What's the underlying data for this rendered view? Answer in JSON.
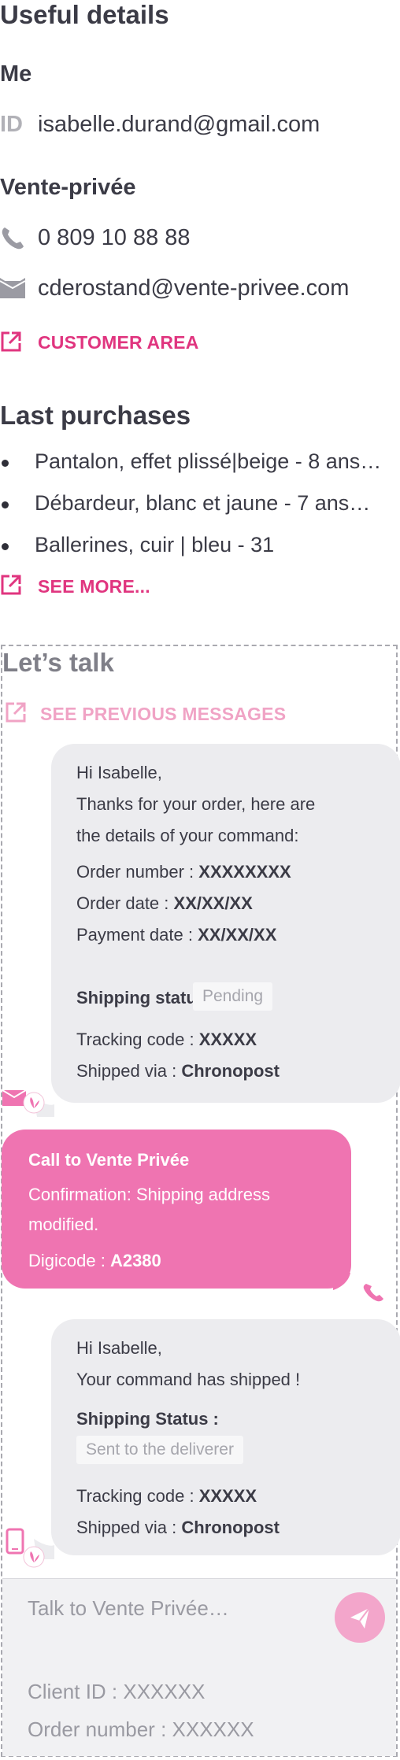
{
  "useful_details": {
    "title": "Useful details",
    "me": {
      "heading": "Me",
      "id_label": "ID",
      "email": "isabelle.durand@gmail.com"
    },
    "vente_privee": {
      "heading": "Vente-privée",
      "phone": "0 809 10 88 88",
      "email": "cderostand@vente-privee.com",
      "customer_area_link": "CUSTOMER AREA"
    }
  },
  "last_purchases": {
    "title": "Last purchases",
    "items": [
      "Pantalon, effet plissé|beige - 8 ans…",
      "Débardeur, blanc et jaune - 7 ans…",
      "Ballerines, cuir | bleu - 31"
    ],
    "see_more_link": "SEE MORE..."
  },
  "talk": {
    "title": "Let’s talk",
    "previous_link": "SEE PREVIOUS MESSAGES",
    "message1": {
      "greeting": "Hi Isabelle,",
      "line1": "Thanks for your order, here are",
      "line2": "the details of your command:",
      "order_number_label": "Order number : ",
      "order_number": "XXXXXXXX",
      "order_date_label": "Order date : ",
      "order_date": "XX/XX/XX",
      "payment_date_label": "Payment date : ",
      "payment_date": "XX/XX/XX",
      "shipping_status_label": "Shipping status:",
      "shipping_status": "Pending",
      "tracking_label": "Tracking code : ",
      "tracking_code": "XXXXX",
      "shipped_label": "Shipped via : ",
      "carrier": "Chronopost"
    },
    "call_message": {
      "title": "Call to Vente Privée",
      "line1": "Confirmation: Shipping address",
      "line2": "modified.",
      "digicode_label": "Digicode : ",
      "digicode": "A2380"
    },
    "message2": {
      "greeting": "Hi Isabelle,",
      "line1": "Your command has shipped !",
      "shipping_status_label": "Shipping Status :",
      "shipping_status": "Sent to the deliverer",
      "tracking_label": "Tracking code : ",
      "tracking_code": "XXXXX",
      "shipped_label": "Shipped via : ",
      "carrier": "Chronopost"
    },
    "input": {
      "placeholder": "Talk to Vente Privée…",
      "client_id": "Client ID : XXXXXX",
      "order_number": "Order number : XXXXXX"
    }
  },
  "colors": {
    "accent": "#e0357f",
    "pink_bubble": "#ef74b1",
    "grey_bubble": "#ececef",
    "text": "#3b3b46"
  }
}
